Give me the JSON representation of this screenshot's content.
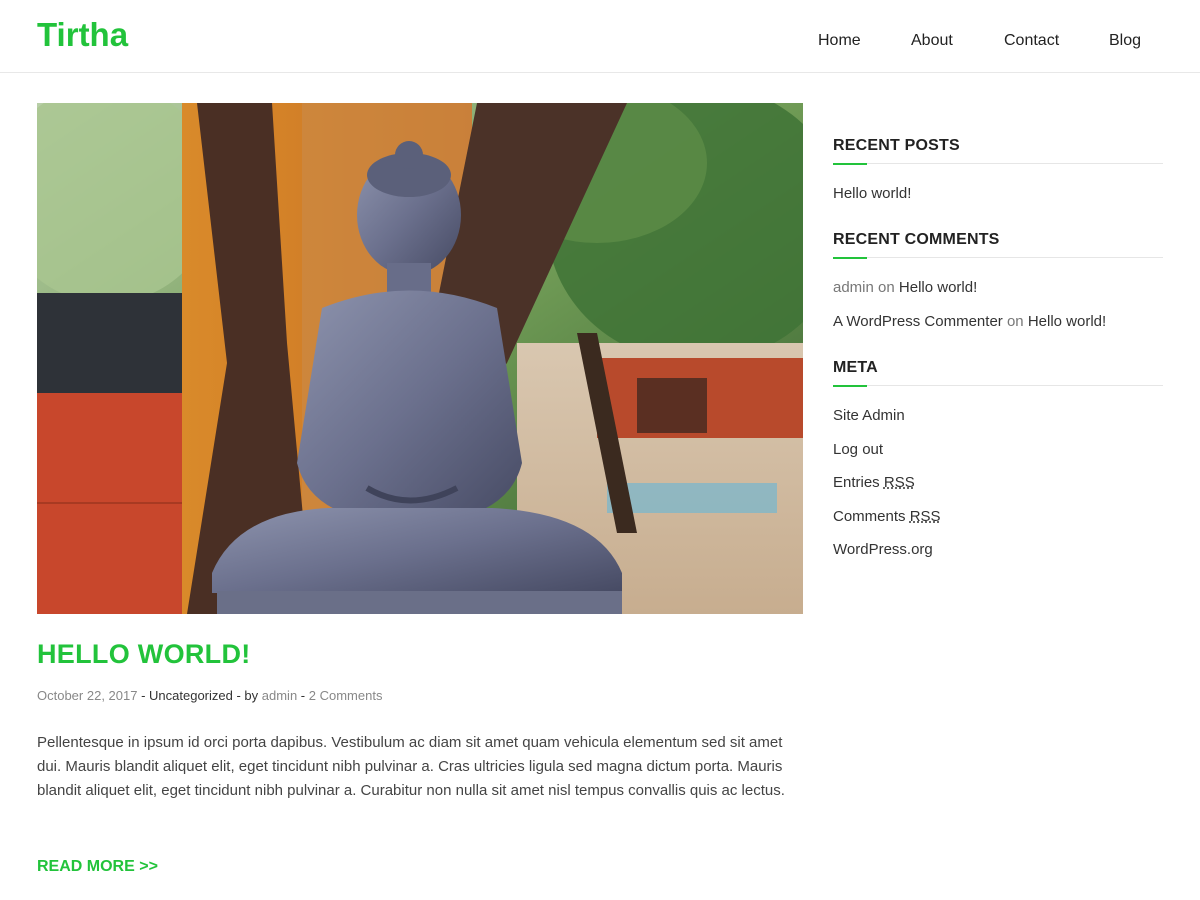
{
  "site": {
    "title": "Tirtha",
    "accent": "#22c33b"
  },
  "nav": {
    "items": [
      "Home",
      "About",
      "Contact",
      "Blog"
    ]
  },
  "post": {
    "title": "HELLO WORLD!",
    "date": "October 22, 2017",
    "sep1": " - ",
    "category": "Uncategorized",
    "by": " - by ",
    "author": "admin",
    "sep2": " - ",
    "comments": "2 Comments",
    "excerpt": "Pellentesque in ipsum id orci porta dapibus. Vestibulum ac diam sit amet quam vehicula elementum sed sit amet dui. Mauris blandit aliquet elit, eget tincidunt nibh pulvinar a. Cras ultricies ligula sed magna dictum porta. Mauris blandit aliquet elit, eget tincidunt nibh pulvinar a. Curabitur non nulla sit amet nisl tempus convallis quis ac lectus.",
    "read_more": "READ MORE >>"
  },
  "sidebar": {
    "recent_posts": {
      "title": "RECENT POSTS",
      "items": [
        "Hello world!"
      ]
    },
    "recent_comments": {
      "title": "RECENT COMMENTS",
      "items": [
        {
          "author": "admin",
          "on": " on ",
          "post": "Hello world!"
        },
        {
          "author": "A WordPress Commenter",
          "on": " on ",
          "post": "Hello world!"
        }
      ]
    },
    "meta": {
      "title": "META",
      "site_admin": "Site Admin",
      "log_out": "Log out",
      "entries_prefix": "Entries ",
      "comments_prefix": "Comments ",
      "rss": "RSS",
      "wordpress": "WordPress.org"
    }
  }
}
